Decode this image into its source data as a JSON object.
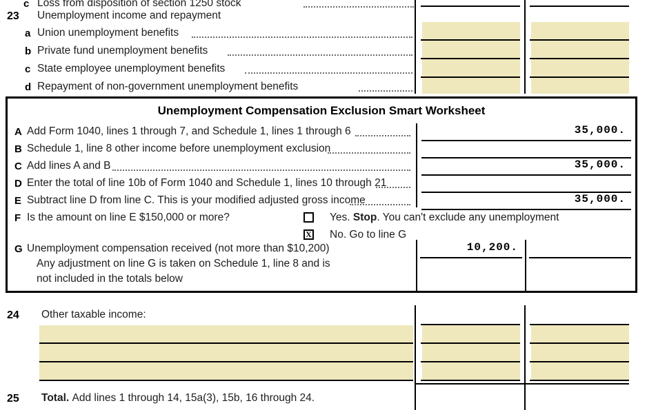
{
  "form": {
    "clipped_top_row": {
      "ref": "c",
      "text": "Loss from disposition of section 1250 stock"
    },
    "line23": {
      "number": "23",
      "title": "Unemployment income and repayment",
      "items": [
        {
          "ref": "a",
          "text": "Union unemployment benefits"
        },
        {
          "ref": "b",
          "text": "Private fund unemployment benefits"
        },
        {
          "ref": "c",
          "text": "State employee unemployment benefits"
        },
        {
          "ref": "d",
          "text": "Repayment of non-government unemployment benefits"
        }
      ]
    },
    "line24": {
      "number": "24",
      "title": "Other taxable income:",
      "blank_rows": 3
    },
    "line25": {
      "number": "25",
      "bold_prefix": "Total.",
      "text": "Add lines 1 through 14, 15a(3), 15b, 16 through 24."
    }
  },
  "worksheet": {
    "title": "Unemployment Compensation Exclusion Smart Worksheet",
    "rows": [
      {
        "ref": "A",
        "text": "Add Form 1040, lines 1 through 7, and Schedule 1, lines 1 through 6",
        "value": "35,000."
      },
      {
        "ref": "B",
        "text": "Schedule 1, line 8 other income before unemployment exclusion",
        "value": ""
      },
      {
        "ref": "C",
        "text": "Add lines A and B",
        "value": "35,000."
      },
      {
        "ref": "D",
        "text": "Enter the total of line 10b of Form 1040 and Schedule 1, lines 10 through 21",
        "value": ""
      },
      {
        "ref": "E",
        "text": "Subtract line D from line C. This is your modified adjusted gross income",
        "value": "35,000."
      }
    ],
    "line_f": {
      "ref": "F",
      "question": "Is the amount on line E $150,000 or more?",
      "options": [
        {
          "checked": false,
          "mark": "",
          "prefix": "Yes. ",
          "bold": "Stop",
          "suffix": ". You can't exclude any unemployment"
        },
        {
          "checked": true,
          "mark": "X",
          "prefix": "No. Go to line G",
          "bold": "",
          "suffix": ""
        }
      ]
    },
    "line_g": {
      "ref": "G",
      "text": "Unemployment compensation received (not more than $10,200)",
      "value": "10,200.",
      "note_line1": "Any adjustment on line G is taken on Schedule 1, line 8 and is",
      "note_line2": "not included in the totals below"
    }
  },
  "colors": {
    "entry_field": "#efe8bc",
    "rule": "#000000",
    "text": "#1d1d1d"
  }
}
